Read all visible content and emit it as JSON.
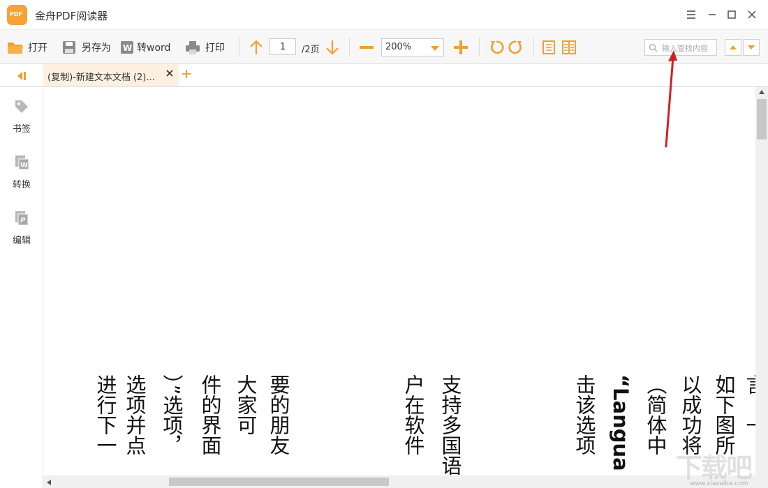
{
  "window": {
    "app_title": "金舟PDF阅读器",
    "logo_text": "PDF"
  },
  "toolbar": {
    "open_label": "打开",
    "save_as_label": "另存为",
    "to_word_label": "转word",
    "print_label": "打印",
    "current_page": "1",
    "total_pages": "/2页",
    "zoom_value": "200%",
    "search_placeholder": "输入查找内容"
  },
  "tabs": [
    {
      "label": "(复制)-新建文本文档 (2)..."
    }
  ],
  "sidebar": {
    "items": [
      {
        "label": "书签",
        "icon": "tag-icon"
      },
      {
        "label": "转换",
        "icon": "convert-word-icon"
      },
      {
        "label": "编辑",
        "icon": "edit-pdf-icon"
      }
    ]
  },
  "document": {
    "columns": [
      {
        "text": "进行下一"
      },
      {
        "text": "选项并点"
      },
      {
        "text": "）”选项，"
      },
      {
        "text": "件的界面"
      },
      {
        "text": "大家可"
      },
      {
        "text": "要的朋友"
      },
      {
        "text": "户在软件"
      },
      {
        "text": "支持多国语"
      },
      {
        "text": "击该选项"
      },
      {
        "text": "“Langua"
      },
      {
        "text": "（简体中"
      },
      {
        "text": "以成功将"
      },
      {
        "text": "如下图所"
      },
      {
        "text": "言，一"
      }
    ]
  },
  "colors": {
    "accent": "#f0a030",
    "annotation_arrow": "#cc2222"
  },
  "watermark": {
    "text": "下载吧",
    "sub": "www.xiazaiba.com"
  }
}
